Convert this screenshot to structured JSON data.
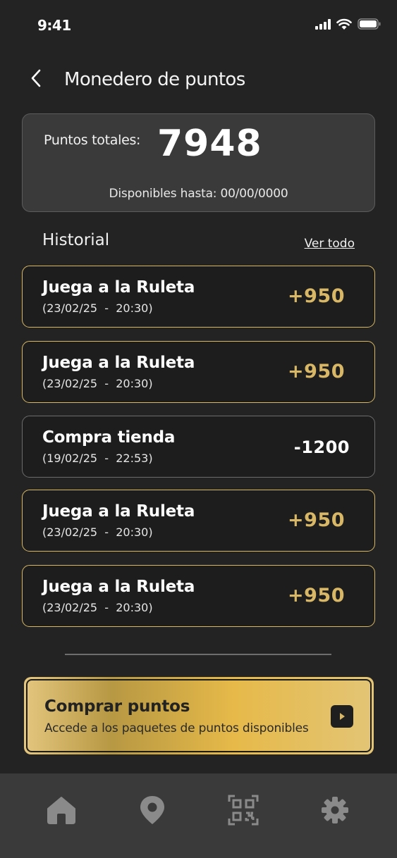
{
  "status_bar": {
    "time": "9:41"
  },
  "header": {
    "title": "Monedero de puntos"
  },
  "points": {
    "label": "Puntos totales:",
    "value": "7948",
    "expiry": "Disponibles hasta: 00/00/0000"
  },
  "history": {
    "title": "Historial",
    "see_all": "Ver todo",
    "items": [
      {
        "title": "Juega a la Ruleta",
        "date": "(23/02/25  -  20:30)",
        "amount": "+950",
        "kind": "positive"
      },
      {
        "title": "Juega a la Ruleta",
        "date": "(23/02/25  -  20:30)",
        "amount": "+950",
        "kind": "positive"
      },
      {
        "title": "Compra tienda",
        "date": "(19/02/25  -  22:53)",
        "amount": "-1200",
        "kind": "negative"
      },
      {
        "title": "Juega a la Ruleta",
        "date": "(23/02/25  -  20:30)",
        "amount": "+950",
        "kind": "positive"
      },
      {
        "title": "Juega a la Ruleta",
        "date": "(23/02/25  -  20:30)",
        "amount": "+950",
        "kind": "positive"
      }
    ]
  },
  "buy": {
    "title": "Comprar puntos",
    "subtitle": "Accede a los paquetes de puntos disponibles",
    "icon": "play-arrow-icon"
  },
  "nav": {
    "items": [
      {
        "icon": "home-icon"
      },
      {
        "icon": "location-pin-icon"
      },
      {
        "icon": "qr-code-icon"
      },
      {
        "icon": "gear-icon"
      }
    ]
  },
  "colors": {
    "background": "#232323",
    "gold": "#d8b766",
    "card": "#3a3a3a",
    "nav": "#3a3a3a",
    "icon_gray": "#8a8a8a"
  }
}
